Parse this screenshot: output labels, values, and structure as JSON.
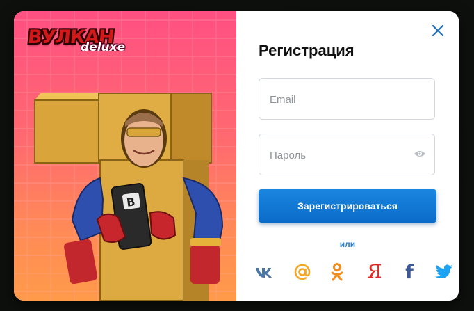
{
  "brand": {
    "logo_main": "ВУЛКАН",
    "logo_sub": "deluxe"
  },
  "form": {
    "title": "Регистрация",
    "email_placeholder": "Email",
    "password_placeholder": "Пароль",
    "submit_label": "Зарегистрироваться",
    "or_label": "или"
  },
  "social": [
    {
      "name": "vk",
      "icon": "vk-icon",
      "color": "#4a76a8"
    },
    {
      "name": "mail",
      "icon": "at-icon",
      "color": "#f5a623"
    },
    {
      "name": "odnoklassniki",
      "icon": "ok-icon",
      "color": "#f28c1d"
    },
    {
      "name": "yandex",
      "icon": "yandex-icon",
      "glyph": "Я",
      "color": "#e52620"
    },
    {
      "name": "facebook",
      "icon": "facebook-icon",
      "glyph": "f",
      "color": "#3b5998"
    },
    {
      "name": "twitter",
      "icon": "twitter-icon",
      "color": "#1da1f2"
    }
  ],
  "colors": {
    "accent": "#1178d6",
    "close": "#1f6fb8",
    "promo_top": "#ff4f83",
    "promo_bottom": "#ff9a4a"
  }
}
